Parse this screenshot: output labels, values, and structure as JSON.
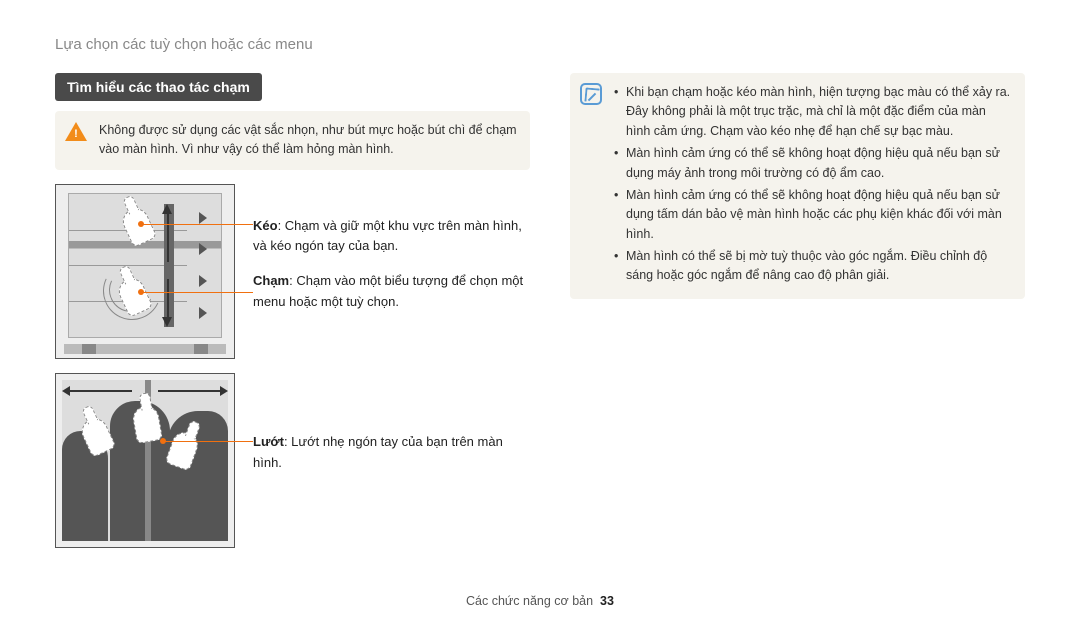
{
  "header": {
    "breadcrumb": "Lựa chọn các tuỳ chọn hoặc các menu"
  },
  "section": {
    "title": "Tìm hiểu các thao tác chạm"
  },
  "warning": {
    "text": "Không được sử dụng các vật sắc nhọn, như bút mực hoặc bút chì để chạm vào màn hình. Vì như vậy có thể làm hỏng màn hình."
  },
  "gestures": {
    "drag": {
      "label": "Kéo",
      "desc": ": Chạm và giữ một khu vực trên màn hình, và kéo ngón tay của bạn."
    },
    "tap": {
      "label": "Chạm",
      "desc": ": Chạm vào một biểu tượng để chọn một menu hoặc một tuỳ chọn."
    },
    "flick": {
      "label": "Lướt",
      "desc": ": Lướt nhẹ ngón tay của bạn trên màn hình."
    }
  },
  "notes": {
    "items": [
      "Khi bạn chạm hoặc kéo màn hình, hiện tượng bạc màu có thể xảy ra. Đây không phải là một trục trặc, mà chỉ là một đặc điểm của màn hình cảm ứng. Chạm vào kéo nhẹ để hạn chế sự bạc màu.",
      "Màn hình cảm ứng có thể sẽ không hoạt động hiệu quả nếu bạn sử dụng máy ảnh trong môi trường có độ ẩm cao.",
      "Màn hình cảm ứng có thể sẽ không hoạt động hiệu quả nếu bạn sử dụng tấm dán bảo vệ màn hình hoặc các phụ kiện khác đối với màn hình.",
      "Màn hình có thể sẽ bị mờ tuỳ thuộc vào góc ngắm. Điều chỉnh độ sáng hoặc góc ngắm để nâng cao độ phân giải."
    ]
  },
  "footer": {
    "section_label": "Các chức năng cơ bản",
    "page_number": "33"
  }
}
